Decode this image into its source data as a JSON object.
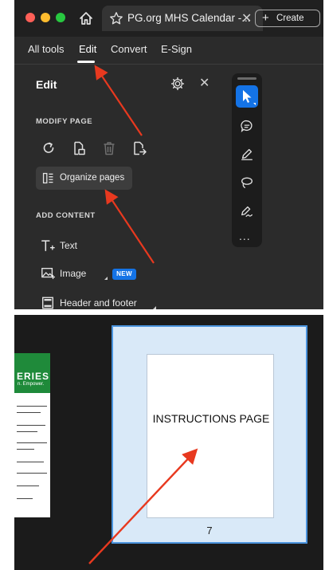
{
  "browser": {
    "tab_title": "PG.org MHS Calendar -...",
    "create_label": "Create"
  },
  "menu": {
    "all_tools": "All tools",
    "edit": "Edit",
    "convert": "Convert",
    "esign": "E-Sign"
  },
  "edit_panel": {
    "title": "Edit",
    "modify_heading": "MODIFY PAGE",
    "organize_label": "Organize pages",
    "add_heading": "ADD CONTENT",
    "text_label": "Text",
    "image_label": "Image",
    "new_badge": "NEW",
    "header_footer_label": "Header and footer"
  },
  "tool_rail": {
    "more": "..."
  },
  "thumbnails": {
    "prev_series": "ERIES",
    "prev_tag": "n. Empower.",
    "page_text": "INSTRUCTIONS PAGE",
    "page_number": "7"
  },
  "colors": {
    "accent_blue": "#1473e6",
    "arrow_red": "#e8391f",
    "selection_fill": "#d9e9f8"
  },
  "icons": [
    "home-icon",
    "star-icon",
    "close-icon",
    "gear-icon",
    "rotate-icon",
    "extract-icon",
    "delete-icon",
    "insert-icon",
    "organize-icon",
    "text-icon",
    "image-icon",
    "header-footer-icon",
    "select-icon",
    "comment-icon",
    "draw-icon",
    "lasso-icon",
    "sign-icon"
  ]
}
